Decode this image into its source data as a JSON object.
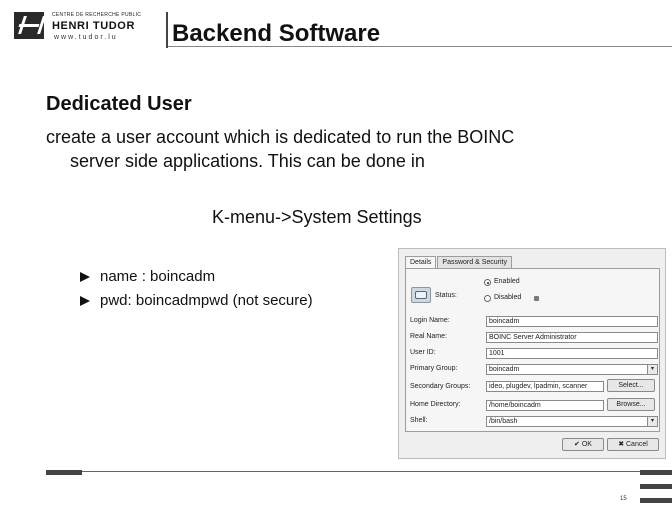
{
  "header": {
    "logo_small": "CENTRE DE RECHERCHE PUBLIC",
    "logo_main": "HENRI TUDOR",
    "logo_url": "www.tudor.lu",
    "title": "Backend Software"
  },
  "content": {
    "heading": "Dedicated User",
    "para_line1": "create a user account which is dedicated to run the BOINC",
    "para_line2": "server side applications. This can be done in",
    "kmenu": "K-menu->System Settings",
    "bullets": [
      "name : boincadm",
      "pwd: boincadmpwd (not secure)"
    ]
  },
  "dialog": {
    "tabs": [
      "Details",
      "Password & Security"
    ],
    "status_label": "Status:",
    "enabled_label": "Enabled",
    "disabled_label": "Disabled",
    "login_label": "Login Name:",
    "login_value": "boincadm",
    "realname_label": "Real Name:",
    "realname_value": "BOINC Server Administrator",
    "userid_label": "User ID:",
    "userid_value": "1001",
    "primarygroup_label": "Primary Group:",
    "primarygroup_value": "boincadm",
    "secgroups_label": "Secondary Groups:",
    "secgroups_value": "ideo, plugdev, lpadmin, scanner",
    "select_button": "Select...",
    "homedir_label": "Home Directory:",
    "homedir_value": "/home/boincadm",
    "browse_button": "Browse...",
    "shell_label": "Shell:",
    "shell_value": "/bin/bash",
    "ok_button": "OK",
    "cancel_button": "Cancel"
  },
  "footer": {
    "page_number": "15"
  }
}
